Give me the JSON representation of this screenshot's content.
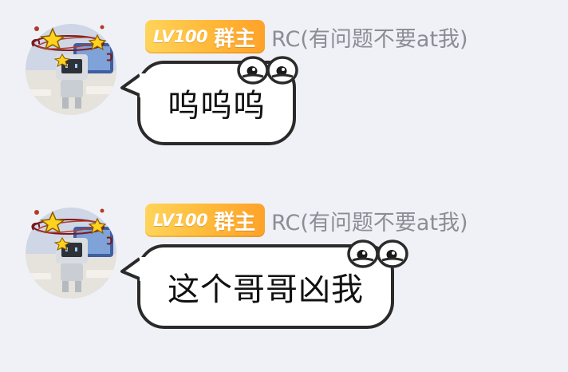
{
  "messages": [
    {
      "level_badge": "LV100",
      "role_badge": "群主",
      "sender": "RC(有问题不要at我)",
      "text": "呜呜呜"
    },
    {
      "level_badge": "LV100",
      "role_badge": "群主",
      "sender": "RC(有问题不要at我)",
      "text": "这个哥哥凶我"
    }
  ],
  "colors": {
    "background": "#f0f1f6",
    "badge": "#ffb838",
    "sender_text": "#8a8d96",
    "bubble_border": "#2a2a2a"
  },
  "icons": [
    "avatar-dizzy-robot",
    "level-badge",
    "bubble-eyes-decoration"
  ]
}
